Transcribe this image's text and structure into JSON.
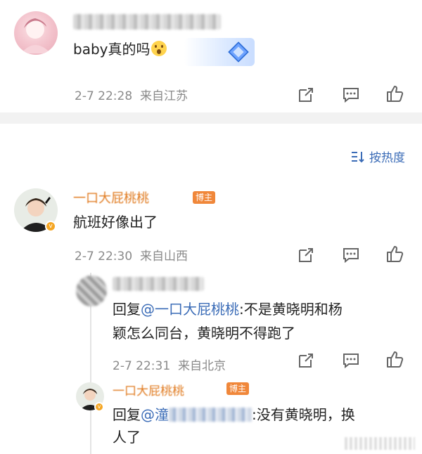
{
  "comment1": {
    "avatar": "avatar-pink-anime",
    "text": "baby真的吗",
    "emoji": "shocked-face-emoji",
    "sticker": "diamond-sticker-icon",
    "time": "2-7 22:28",
    "location": "来自江苏"
  },
  "sort": {
    "icon": "sort-icon",
    "label": "按热度"
  },
  "comment2": {
    "name": "一口大屁桃桃",
    "badge": "博主",
    "text": "航班好像出了",
    "time": "2-7 22:30",
    "location": "来自山西"
  },
  "reply1": {
    "prefix": "回复",
    "mention": "@一口大屁桃桃",
    "line1_rest": ":不是黄晓明和杨",
    "line2": "颖怎么同台，黄晓明不得跑了",
    "time": "2-7 22:31",
    "location": "来自北京"
  },
  "reply2": {
    "name": "一口大屁桃桃",
    "badge": "博主",
    "prefix": "回复",
    "mention": "@潼",
    "line1_rest": ":没有黄晓明，换",
    "line2": "人了"
  },
  "colors": {
    "accent": "#3b6cb7",
    "orange": "#e07a1f",
    "meta": "#8a8a8a"
  }
}
